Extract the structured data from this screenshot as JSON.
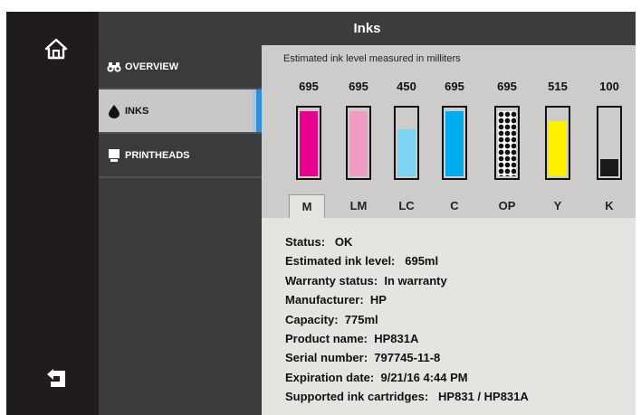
{
  "header": {
    "title": "Inks"
  },
  "nav": {
    "items": [
      {
        "label": "OVERVIEW",
        "icon": "binoculars-icon"
      },
      {
        "label": "INKS",
        "icon": "ink-drop-icon"
      },
      {
        "label": "PRINTHEADS",
        "icon": "printhead-icon"
      }
    ]
  },
  "inks": {
    "caption": "Estimated ink level measured in milliters",
    "cartridges": [
      {
        "name": "M",
        "value": "695",
        "level": 0.97,
        "color": "#e6008c"
      },
      {
        "name": "LM",
        "value": "695",
        "level": 0.97,
        "color": "#f09cc4"
      },
      {
        "name": "LC",
        "value": "450",
        "level": 0.7,
        "color": "#7dd3f2"
      },
      {
        "name": "C",
        "value": "695",
        "level": 0.97,
        "color": "#00aeef"
      },
      {
        "name": "OP",
        "value": "695",
        "level": 0.97,
        "color": "pattern"
      },
      {
        "name": "Y",
        "value": "515",
        "level": 0.82,
        "color": "#fff200"
      },
      {
        "name": "K",
        "value": "100",
        "level": 0.25,
        "color": "#1a1a1a"
      }
    ],
    "selected_tab": "M"
  },
  "details": {
    "status_label": "Status:",
    "status_value": "OK",
    "level_label": "Estimated ink level:",
    "level_value": "695ml",
    "warranty_label": "Warranty status:",
    "warranty_value": "In warranty",
    "manufacturer_label": "Manufacturer:",
    "manufacturer_value": "HP",
    "capacity_label": "Capacity:",
    "capacity_value": "775ml",
    "product_label": "Product name:",
    "product_value": "HP831A",
    "serial_label": "Serial number:",
    "serial_value": "797745-11-8",
    "expiration_label": "Expiration date:",
    "expiration_value": "9/21/16 4:44 PM",
    "supported_label": "Supported ink cartridges:",
    "supported_value": "HP831 / HP831A"
  }
}
